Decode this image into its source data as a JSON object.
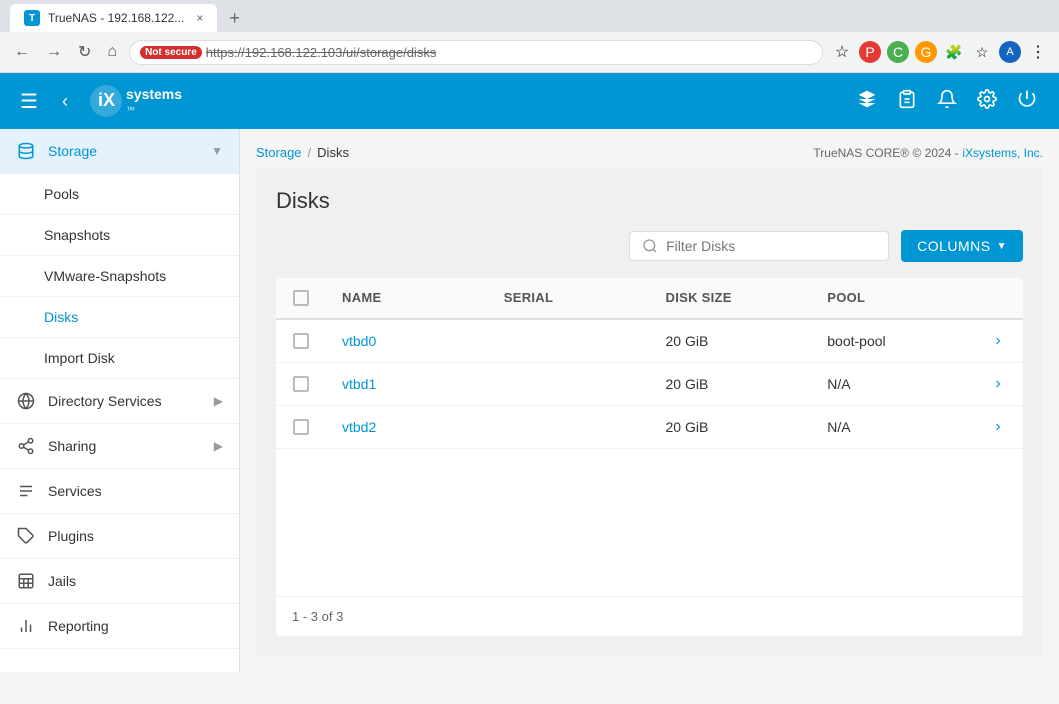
{
  "browser": {
    "tab_title": "TrueNAS - 192.168.122...",
    "url": "https://192.168.122.103/ui/storage/disks",
    "url_display": "https://192.168.122.103/ui/storage/disks",
    "not_secure_label": "Not secure",
    "new_tab_label": "+"
  },
  "header": {
    "logo_text": "iX systems",
    "hamburger_label": "☰",
    "back_label": "‹",
    "icons": {
      "layers": "⬡",
      "clipboard": "📋",
      "bell": "🔔",
      "gear": "⚙",
      "power": "⏻"
    }
  },
  "sidebar": {
    "storage_label": "Storage",
    "items": [
      {
        "id": "pools",
        "label": "Pools",
        "icon": "",
        "has_arrow": false
      },
      {
        "id": "snapshots",
        "label": "Snapshots",
        "icon": "",
        "has_arrow": false
      },
      {
        "id": "vmware-snapshots",
        "label": "VMware-Snapshots",
        "icon": "",
        "has_arrow": false
      },
      {
        "id": "disks",
        "label": "Disks",
        "icon": "",
        "has_arrow": false,
        "active": true
      },
      {
        "id": "import-disk",
        "label": "Import Disk",
        "icon": "",
        "has_arrow": false
      }
    ],
    "directory_services": {
      "label": "Directory Services",
      "has_arrow": true
    },
    "sharing": {
      "label": "Sharing",
      "has_arrow": true
    },
    "services": {
      "label": "Services",
      "has_arrow": false
    },
    "plugins": {
      "label": "Plugins",
      "has_arrow": false
    },
    "jails": {
      "label": "Jails",
      "has_arrow": false
    },
    "reporting": {
      "label": "Reporting",
      "has_arrow": false
    }
  },
  "breadcrumb": {
    "parent": "Storage",
    "current": "Disks",
    "version": "TrueNAS CORE® © 2024 -",
    "company": "iXsystems, Inc."
  },
  "disks": {
    "title": "Disks",
    "filter_placeholder": "Filter Disks",
    "columns_label": "COLUMNS",
    "table": {
      "headers": [
        "",
        "Name",
        "Serial",
        "Disk Size",
        "Pool",
        ""
      ],
      "rows": [
        {
          "name": "vtbd0",
          "serial": "",
          "disk_size": "20 GiB",
          "pool": "boot-pool"
        },
        {
          "name": "vtbd1",
          "serial": "",
          "disk_size": "20 GiB",
          "pool": "N/A"
        },
        {
          "name": "vtbd2",
          "serial": "",
          "disk_size": "20 GiB",
          "pool": "N/A"
        }
      ]
    },
    "pagination": "1 - 3 of 3"
  }
}
